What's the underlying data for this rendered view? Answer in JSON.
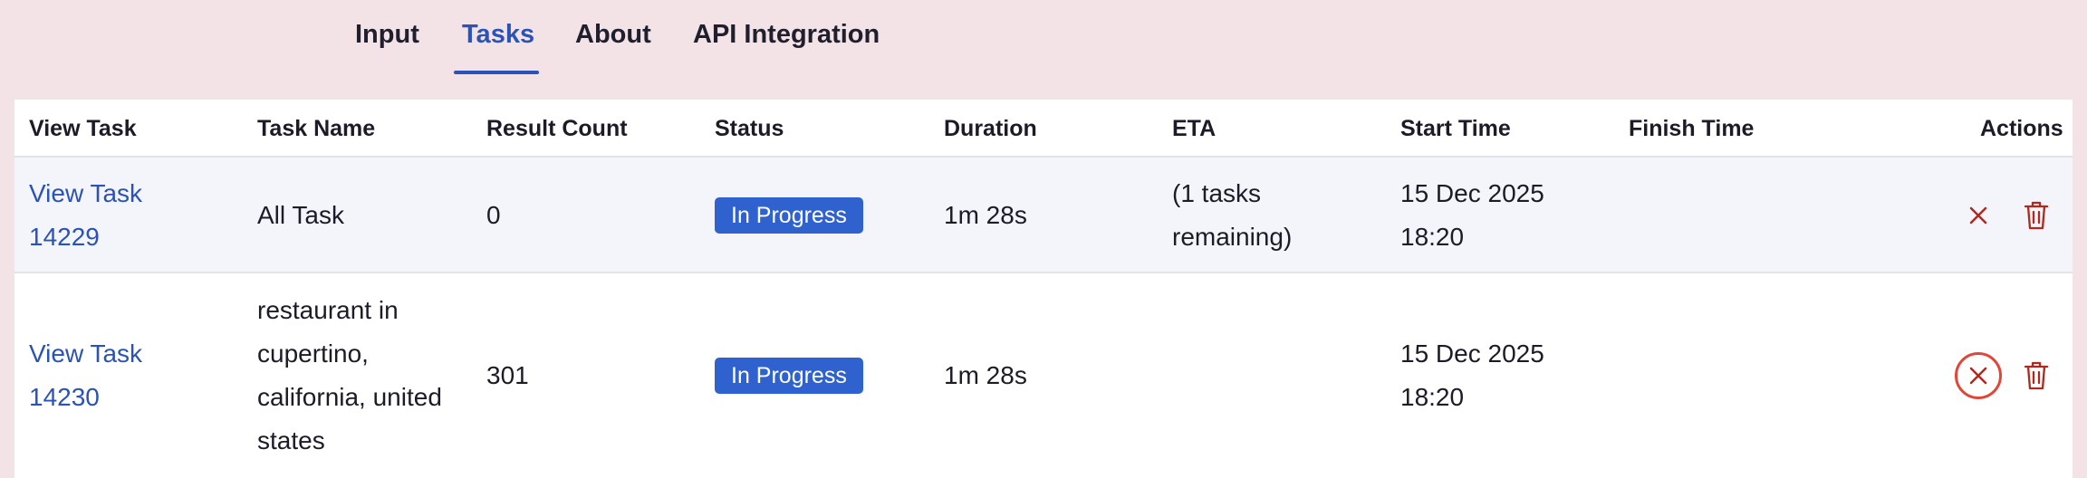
{
  "tabs": [
    {
      "label": "Input"
    },
    {
      "label": "Tasks"
    },
    {
      "label": "About"
    },
    {
      "label": "API Integration"
    }
  ],
  "active_tab": "Tasks",
  "table": {
    "headers": [
      "View Task",
      "Task Name",
      "Result Count",
      "Status",
      "Duration",
      "ETA",
      "Start Time",
      "Finish Time",
      "Actions"
    ],
    "rows": [
      {
        "view_task_line1": "View Task",
        "view_task_line2": "14229",
        "task_name_lines": [
          "All Task"
        ],
        "result_count": "0",
        "status": "In Progress",
        "duration": "1m 28s",
        "eta_line1": "(1 tasks",
        "eta_line2": "remaining)",
        "start_line1": "15 Dec 2025",
        "start_line2": "18:20",
        "finish_time": ""
      },
      {
        "view_task_line1": "View Task",
        "view_task_line2": "14230",
        "task_name_lines": [
          "restaurant in",
          "cupertino,",
          "california, united",
          "states"
        ],
        "result_count": "301",
        "status": "In Progress",
        "duration": "1m 28s",
        "eta_line1": "",
        "eta_line2": "",
        "start_line1": "15 Dec 2025",
        "start_line2": "18:20",
        "finish_time": ""
      }
    ]
  },
  "colors": {
    "accent": "#2b52b5",
    "badge": "#2f62cf",
    "danger": "#b0281e",
    "background": "#f3e3e6"
  },
  "icons": {
    "cancel": "close-icon",
    "delete": "trash-icon"
  }
}
